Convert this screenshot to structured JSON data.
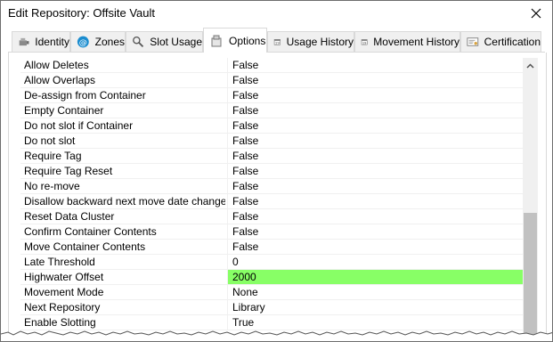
{
  "window": {
    "title": "Edit Repository: Offsite Vault"
  },
  "tabs": [
    {
      "label": "Identity",
      "icon": "identity-icon",
      "active": false
    },
    {
      "label": "Zones",
      "icon": "zones-icon",
      "active": false
    },
    {
      "label": "Slot Usage",
      "icon": "magnifier-icon",
      "active": false
    },
    {
      "label": "Options",
      "icon": "options-icon",
      "active": true
    },
    {
      "label": "Usage History",
      "icon": "calendar-icon",
      "active": false
    },
    {
      "label": "Movement History",
      "icon": "calendar-icon",
      "active": false
    },
    {
      "label": "Certification",
      "icon": "certificate-icon",
      "active": false
    }
  ],
  "options": [
    {
      "name": "Allow Deletes",
      "value": "False"
    },
    {
      "name": "Allow Overlaps",
      "value": "False"
    },
    {
      "name": "De-assign from Container",
      "value": "False"
    },
    {
      "name": "Empty Container",
      "value": "False"
    },
    {
      "name": "Do not slot if Container",
      "value": "False"
    },
    {
      "name": "Do not slot",
      "value": "False"
    },
    {
      "name": "Require Tag",
      "value": "False"
    },
    {
      "name": "Require Tag Reset",
      "value": "False"
    },
    {
      "name": "No re-move",
      "value": "False"
    },
    {
      "name": "Disallow backward next move date changes",
      "value": "False"
    },
    {
      "name": "Reset Data Cluster",
      "value": "False"
    },
    {
      "name": "Confirm Container Contents",
      "value": "False"
    },
    {
      "name": "Move Container Contents",
      "value": "False"
    },
    {
      "name": "Late Threshold",
      "value": "0"
    },
    {
      "name": "Highwater Offset",
      "value": "2000",
      "highlighted": true
    },
    {
      "name": "Movement Mode",
      "value": "None"
    },
    {
      "name": "Next Repository",
      "value": "Library"
    },
    {
      "name": "Enable Slotting",
      "value": "True"
    }
  ],
  "colors": {
    "highlight": "#88ff66",
    "scroll_thumb": "#c1c1c1",
    "zones_badge": "#1a8ccf"
  }
}
